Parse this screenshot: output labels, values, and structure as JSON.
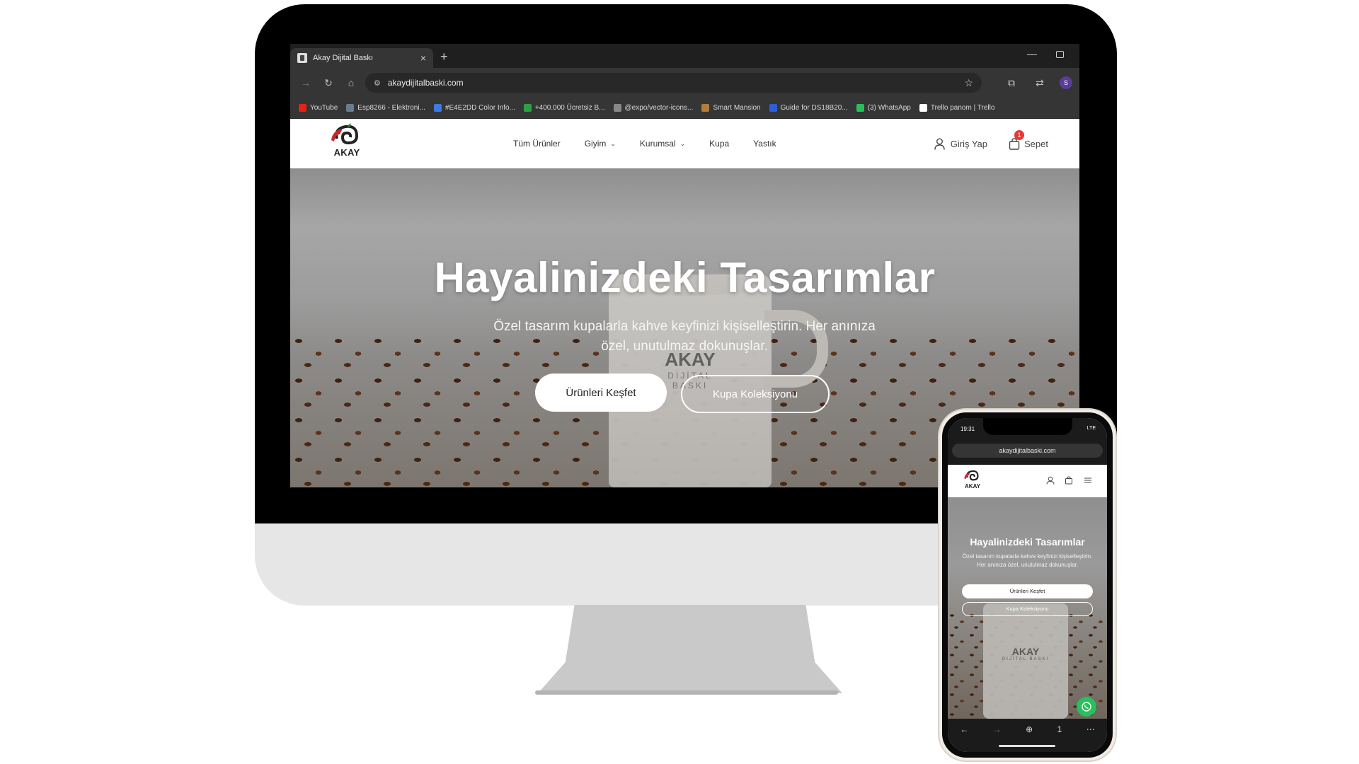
{
  "browser": {
    "tab_title": "Akay Dijital Baskı",
    "url": "akaydijitalbaski.com",
    "profile_initial": "S",
    "bookmarks": [
      {
        "label": "YouTube",
        "color": "#e62117"
      },
      {
        "label": "Esp8266 - Elektroni...",
        "color": "#6b7b8c"
      },
      {
        "label": "#E4E2DD Color Info...",
        "color": "#3c7be0"
      },
      {
        "label": "+400.000 Ücretsiz B...",
        "color": "#2ea043"
      },
      {
        "label": "@expo/vector-icons...",
        "color": "#888888"
      },
      {
        "label": "Smart Mansion",
        "color": "#b07d3a"
      },
      {
        "label": "Guide for DS18B20...",
        "color": "#2b5fd9"
      },
      {
        "label": "(3) WhatsApp",
        "color": "#25c15a"
      },
      {
        "label": "Trello panom | Trello",
        "color": "#ffffff"
      }
    ]
  },
  "site": {
    "logo_text": "AKAY",
    "nav": [
      {
        "label": "Tüm Ürünler",
        "dropdown": false
      },
      {
        "label": "Giyim",
        "dropdown": true
      },
      {
        "label": "Kurumsal",
        "dropdown": true
      },
      {
        "label": "Kupa",
        "dropdown": false
      },
      {
        "label": "Yastık",
        "dropdown": false
      }
    ],
    "login_label": "Giriş Yap",
    "cart_label": "Sepet",
    "cart_count": "1",
    "hero": {
      "title": "Hayalinizdeki Tasarımlar",
      "subtitle": "Özel tasarım kupalarla kahve keyfinizi kişiselleştirin. Her anınıza özel, unutulmaz dokunuşlar.",
      "primary_button": "Ürünleri Keşfet",
      "secondary_button": "Kupa Koleksiyonu",
      "mug_brand": "AKAY",
      "mug_brand_sub": "DİJİTAL BASKI"
    }
  },
  "phone": {
    "time": "19:31",
    "signal": "LTE",
    "url": "akaydijitalbaski.com",
    "logo_text": "AKAY",
    "hero_title": "Hayalinizdeki Tasarımlar",
    "hero_subtitle": "Özel tasarım kupalarla kahve keyfinizi kişiselleştirin. Her anınıza özel, unutulmaz dokunuşlar.",
    "primary_button": "Ürünleri Keşfet",
    "secondary_button": "Kupa Koleksiyonu",
    "mug_brand": "AKAY",
    "mug_brand_sub": "DİJİTAL BASKI",
    "tab_count": "1"
  }
}
